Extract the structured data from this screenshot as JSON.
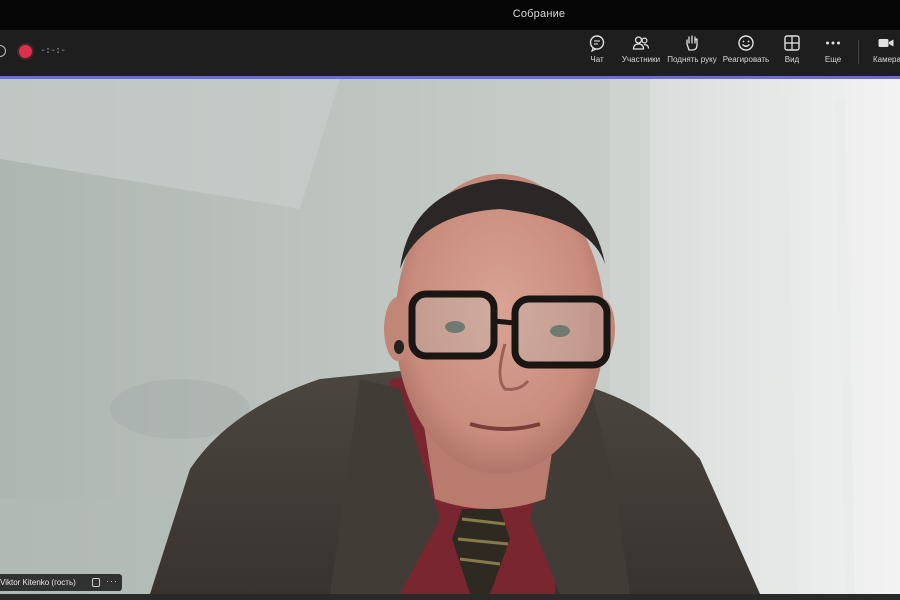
{
  "window": {
    "title": "Собрание"
  },
  "status": {
    "timer": "-:-:-"
  },
  "toolbar": {
    "chat": "Чат",
    "participants": "Участники",
    "raise_hand": "Поднять руку",
    "react": "Реагировать",
    "view": "Вид",
    "more": "Еще",
    "camera": "Камера"
  },
  "participant": {
    "name": "Viktor Kitenko (гость)",
    "more": "···"
  },
  "colors": {
    "accent": "#6b6fc5",
    "record": "#d9324a",
    "toolbar_bg": "#1e1e1e"
  }
}
